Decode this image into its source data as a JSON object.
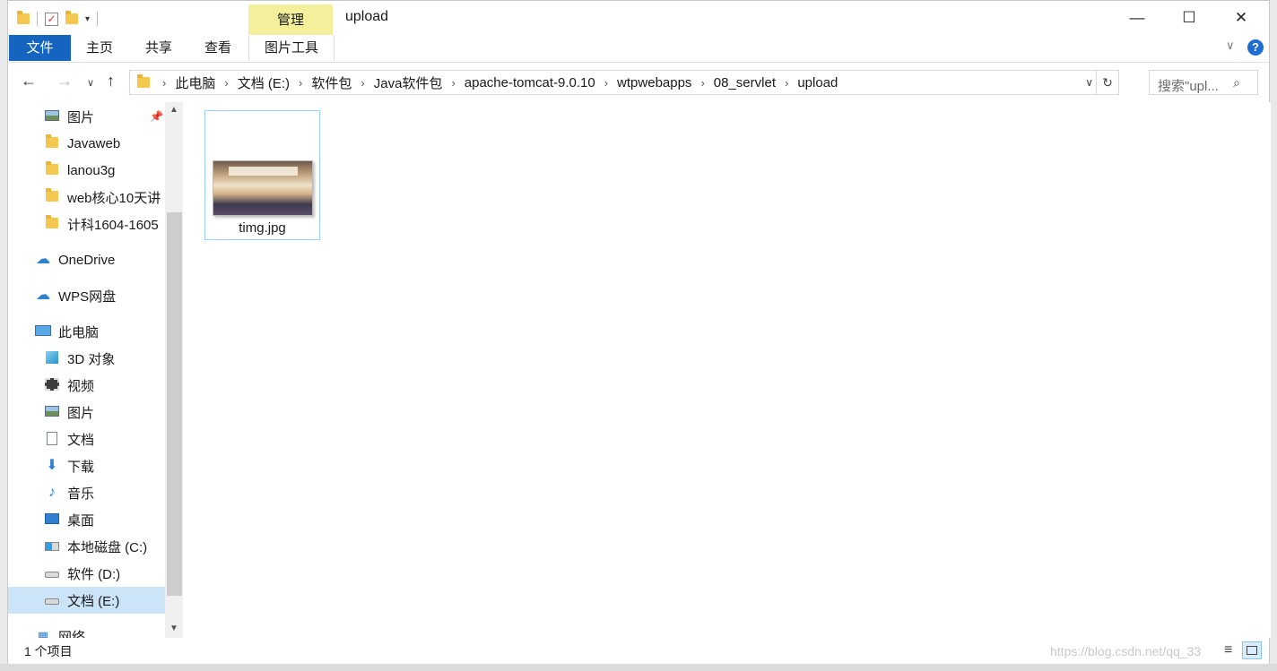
{
  "quick_access": {
    "icons": [
      "folder-icon",
      "properties-icon",
      "new-folder-icon",
      "customize-dropdown-icon"
    ]
  },
  "title": {
    "context_tab": "管理",
    "window_title": "upload",
    "minimize_glyph": "—",
    "maximize_glyph": "☐",
    "close_glyph": "✕"
  },
  "ribbon": {
    "tabs": [
      "文件",
      "主页",
      "共享",
      "查看",
      "图片工具"
    ],
    "expand_glyph": "∨",
    "help_glyph": "?"
  },
  "nav": {
    "back_glyph": "←",
    "forward_glyph": "→",
    "recent_glyph": "∨",
    "up_glyph": "↑",
    "breadcrumbs": [
      "此电脑",
      "文档 (E:)",
      "软件包",
      "Java软件包",
      "apache-tomcat-9.0.10",
      "wtpwebapps",
      "08_servlet",
      "upload"
    ],
    "refresh_glyph": "↻",
    "dropdown_glyph": "∨",
    "search_placeholder": "搜索\"upl...",
    "search_glyph": "⌕"
  },
  "sidebar": {
    "items": [
      {
        "label": "图片",
        "icon": "pictures-icon",
        "pinned": true
      },
      {
        "label": "Javaweb",
        "icon": "folder-icon"
      },
      {
        "label": "lanou3g",
        "icon": "folder-icon"
      },
      {
        "label": "web核心10天讲",
        "icon": "folder-icon"
      },
      {
        "label": "计科1604-1605",
        "icon": "folder-icon"
      },
      {
        "label": "OneDrive",
        "icon": "onedrive-cloud-icon"
      },
      {
        "label": "WPS网盘",
        "icon": "wps-cloud-icon"
      },
      {
        "label": "此电脑",
        "icon": "this-pc-icon"
      },
      {
        "label": "3D 对象",
        "icon": "3d-objects-icon"
      },
      {
        "label": "视频",
        "icon": "videos-icon"
      },
      {
        "label": "图片",
        "icon": "pictures-icon"
      },
      {
        "label": "文档",
        "icon": "documents-icon"
      },
      {
        "label": "下载",
        "icon": "downloads-icon"
      },
      {
        "label": "音乐",
        "icon": "music-icon"
      },
      {
        "label": "桌面",
        "icon": "desktop-icon"
      },
      {
        "label": "本地磁盘 (C:)",
        "icon": "windows-drive-icon"
      },
      {
        "label": "软件 (D:)",
        "icon": "drive-icon"
      },
      {
        "label": "文档 (E:)",
        "icon": "drive-icon",
        "selected": true
      },
      {
        "label": "网络",
        "icon": "network-icon"
      }
    ]
  },
  "content": {
    "files": [
      {
        "name": "timg.jpg",
        "icon": "image-thumbnail"
      }
    ]
  },
  "status": {
    "item_count": "1 个项目",
    "watermark": "https://blog.csdn.net/qq_33"
  }
}
